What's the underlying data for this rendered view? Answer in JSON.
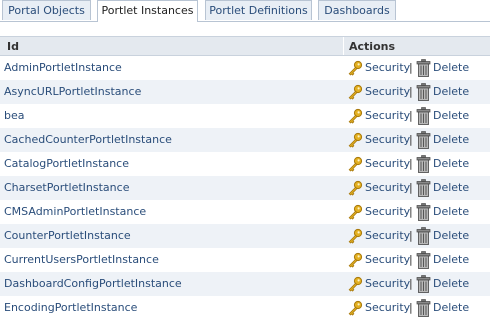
{
  "tabs": [
    {
      "label": "Portal Objects",
      "active": false
    },
    {
      "label": "Portlet Instances",
      "active": true
    },
    {
      "label": "Portlet Definitions",
      "active": false
    },
    {
      "label": "Dashboards",
      "active": false
    }
  ],
  "table": {
    "headers": {
      "id": "Id",
      "actions": "Actions"
    },
    "security_label": "Security",
    "separator": "|",
    "delete_label": "Delete",
    "rows": [
      {
        "id": "AdminPortletInstance"
      },
      {
        "id": "AsyncURLPortletInstance"
      },
      {
        "id": "bea"
      },
      {
        "id": "CachedCounterPortletInstance"
      },
      {
        "id": "CatalogPortletInstance"
      },
      {
        "id": "CharsetPortletInstance"
      },
      {
        "id": "CMSAdminPortletInstance"
      },
      {
        "id": "CounterPortletInstance"
      },
      {
        "id": "CurrentUsersPortletInstance"
      },
      {
        "id": "DashboardConfigPortletInstance"
      },
      {
        "id": "EncodingPortletInstance"
      }
    ]
  },
  "colors": {
    "link": "#2a4d7a",
    "header_bg": "#e4e9ef",
    "alt_row_bg": "#eef2f7",
    "tab_bg": "#e8eef5"
  },
  "icons": {
    "security": "key-icon",
    "delete": "trash-icon"
  }
}
